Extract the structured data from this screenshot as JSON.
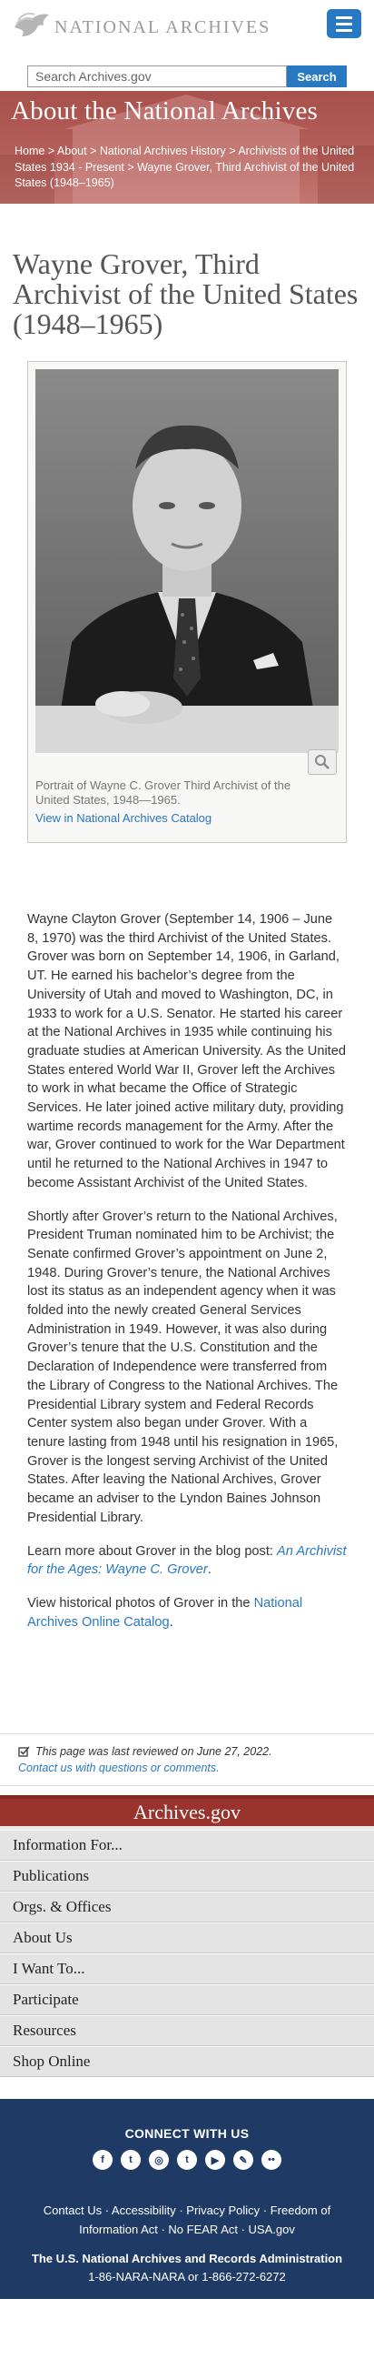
{
  "header": {
    "logo_text": "NATIONAL ARCHIVES",
    "search_placeholder": "Search Archives.gov",
    "search_button": "Search"
  },
  "banner": {
    "title": "About the National Archives",
    "breadcrumb": [
      "Home",
      "About",
      "National Archives History",
      "Archivists of the United States 1934 - Present",
      "Wayne Grover, Third Archivist of the United States (1948–1965)"
    ],
    "separator": " > "
  },
  "page_title": "Wayne Grover, Third Archivist of the United States (1948–1965)",
  "figure": {
    "caption": "Portrait of Wayne C. Grover Third Archivist of the United States, 1948—1965.",
    "catalog_link": "View in National Archives Catalog"
  },
  "article": {
    "p1": "Wayne Clayton Grover (September 14, 1906 – June 8, 1970) was the third Archivist of the United States. Grover was born on September 14, 1906, in Garland, UT. He earned his bachelor’s degree from the University of Utah and moved to Washington, DC, in 1933 to work for a U.S. Senator. He started his career at the National Archives in 1935 while continuing his graduate studies at American University. As the United States entered World War II, Grover left the Archives to work in what became the Office of Strategic Services. He later joined active military duty, providing wartime records management for the Army. After the war, Grover continued to work for the War Department until he returned to the National Archives in 1947 to become Assistant Archivist of the United States.",
    "p2": "Shortly after Grover’s return to the National Archives, President Truman nominated him to be Archivist; the Senate confirmed Grover’s appointment on June 2, 1948. During Grover’s tenure, the National Archives lost its status as an independent agency when it was folded into the newly created General Services Administration in 1949. However, it was also during Grover’s tenure that the U.S. Constitution and the Declaration of Independence were transferred from the Library of Congress to the National Archives. The Presidential Library system and Federal Records Center system also began under Grover. With a tenure lasting from 1948 until his resignation in 1965, Grover is the longest serving Archivist of the United States. After leaving the National Archives, Grover became an adviser to the Lyndon Baines Johnson Presidential Library.",
    "p3_prefix": "Learn more about Grover in the blog post: ",
    "p3_link": "An Archivist for the Ages: Wayne C. Grover",
    "p3_suffix": ".",
    "p4_prefix": "View historical photos of Grover in the ",
    "p4_link": "National Archives Online Catalog",
    "p4_suffix": "."
  },
  "review": {
    "reviewed": "This page was last reviewed on June 27, 2022.",
    "contact": "Contact us with questions or comments."
  },
  "footer": {
    "band_title": "Archives.gov",
    "nav": [
      "Information For...",
      "Publications",
      "Orgs. & Offices",
      "About Us",
      "I Want To...",
      "Participate",
      "Resources",
      "Shop Online"
    ],
    "connect_title": "CONNECT WITH US",
    "social": [
      {
        "icon": "facebook-icon",
        "glyph": "f"
      },
      {
        "icon": "twitter-icon",
        "glyph": "t"
      },
      {
        "icon": "instagram-icon",
        "glyph": "◎"
      },
      {
        "icon": "tumblr-icon",
        "glyph": "t"
      },
      {
        "icon": "youtube-icon",
        "glyph": "▶"
      },
      {
        "icon": "blog-icon",
        "glyph": "✎"
      },
      {
        "icon": "flickr-icon",
        "glyph": "••"
      }
    ],
    "links_line1": "Contact Us · Accessibility · Privacy Policy · Freedom of Information Act · No FEAR Act · USA.gov",
    "org": "The U.S. National Archives and Records Administration",
    "phone": "1-86-NARA-NARA or 1-866-272-6272"
  },
  "colors": {
    "accent_blue": "#2978c2",
    "banner_red": "#a7504c",
    "band_red": "#99332d",
    "footer_navy": "#1f3a64"
  }
}
